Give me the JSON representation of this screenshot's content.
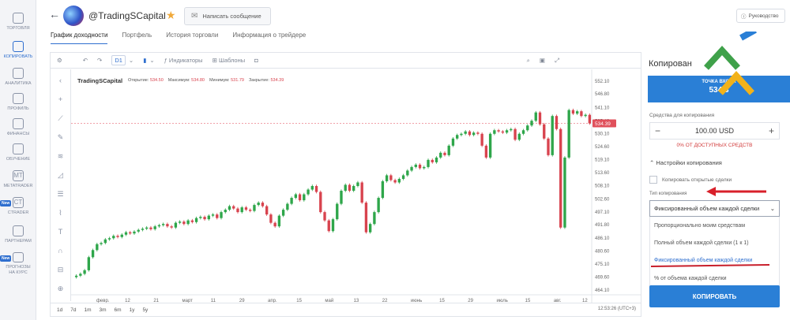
{
  "sidebar": {
    "items": [
      {
        "label": "ТОРГОВЛЯ",
        "icon": "trading-icon"
      },
      {
        "label": "КОПИРОВАТЬ",
        "icon": "copy-icon",
        "active": true
      },
      {
        "label": "АНАЛИТИКА",
        "icon": "analytics-icon"
      },
      {
        "label": "ПРОФИЛЬ",
        "icon": "profile-icon"
      },
      {
        "label": "ФИНАНСЫ",
        "icon": "finance-icon"
      },
      {
        "label": "ОБУЧЕНИЕ",
        "icon": "education-icon"
      },
      {
        "label": "METATRADER",
        "icon": "metatrader-icon",
        "icon_text": "MT"
      },
      {
        "label": "CTRADER",
        "icon": "ctrader-icon",
        "icon_text": "CT",
        "badge": "New"
      },
      {
        "label": "ПАРТНЕРАМ",
        "icon": "partners-icon"
      },
      {
        "label": "ПРОГНОЗЫ\nНА КУРС",
        "icon": "forecast-icon",
        "badge": "New"
      }
    ]
  },
  "header": {
    "trader_name": "@TradingSCapital",
    "message_button": "Написать сообщение",
    "guide_button": "Руководство",
    "tabs": [
      "График доходности",
      "Портфель",
      "История торговли",
      "Информация о трейдере"
    ]
  },
  "toolbar": {
    "timeframe": "D1",
    "indicators": "Индикаторы",
    "templates": "Шаблоны"
  },
  "chart_data": {
    "type": "candlestick",
    "title": "TradingSCapital",
    "ohlc": {
      "open_label": "Открытие:",
      "open": "534.50",
      "high_label": "Максимум:",
      "high": "534.80",
      "low_label": "Минимум:",
      "low": "531.79",
      "close_label": "Закрытие:",
      "close": "534.39"
    },
    "current_price": "534.39",
    "y_ticks": [
      "552.10",
      "546.80",
      "541.10",
      "535.40",
      "530.10",
      "524.60",
      "519.10",
      "513.60",
      "508.10",
      "502.60",
      "497.10",
      "491.80",
      "486.10",
      "480.60",
      "475.10",
      "469.60",
      "464.10"
    ],
    "x_ticks": [
      "февр.",
      "12",
      "21",
      "март",
      "11",
      "29",
      "апр.",
      "15",
      "май",
      "13",
      "22",
      "июнь",
      "15",
      "29",
      "июль",
      "15",
      "авг.",
      "12"
    ],
    "ylim": [
      461.5,
      554.5
    ],
    "closes": [
      470.2,
      471.0,
      472.5,
      478.0,
      481.0,
      483.5,
      484.0,
      485.5,
      486.0,
      487.0,
      486.5,
      487.5,
      488.5,
      488.0,
      488.8,
      489.5,
      490.0,
      490.5,
      489.8,
      491.0,
      491.5,
      492.0,
      491.0,
      490.5,
      492.5,
      493.0,
      492.0,
      493.5,
      492.8,
      494.5,
      495.0,
      494.0,
      495.5,
      496.0,
      494.5,
      497.0,
      498.0,
      499.5,
      498.5,
      497.0,
      499.0,
      498.0,
      497.5,
      500.0,
      501.0,
      499.5,
      496.0,
      492.5,
      491.0,
      495.5,
      498.0,
      500.5,
      503.0,
      504.5,
      502.0,
      504.5,
      506.5,
      508.0,
      505.5,
      497.0,
      493.5,
      489.0,
      494.0,
      500.5,
      506.0,
      508.5,
      506.0,
      508.0,
      509.5,
      501.0,
      488.5,
      492.0,
      497.0,
      503.0,
      510.0,
      512.5,
      510.5,
      509.5,
      511.0,
      512.5,
      514.5,
      516.0,
      517.0,
      515.5,
      516.0,
      519.0,
      518.0,
      520.0,
      522.0,
      521.0,
      525.0,
      528.0,
      529.5,
      530.0,
      531.0,
      529.5,
      530.5,
      530.0,
      525.0,
      520.0,
      530.0,
      531.5,
      531.0,
      530.5,
      531.5,
      532.0,
      527.5,
      530.0,
      531.5,
      533.5,
      535.5,
      539.0,
      534.0,
      528.0,
      521.0,
      537.5,
      532.0,
      490.5,
      520.0,
      540.0,
      538.5,
      539.5,
      537.5,
      538.0,
      534.4
    ]
  },
  "time_ranges": [
    "1d",
    "7d",
    "1m",
    "3m",
    "6m",
    "1y",
    "5y"
  ],
  "clock": "12:53:26 (UTC+3)",
  "copy_panel": {
    "title": "Копирован",
    "badge_text": "ТОЧКА ВХОДА",
    "badge_value": "534.3",
    "funds_label": "Средства для копирования",
    "funds_value": "100.00 USD",
    "minus": "−",
    "plus": "+",
    "funds_pct": "0% ОТ ДОСТУПНЫХ СРЕДСТВ",
    "settings_label": "Настройки копирования",
    "copy_open_trades": "Копировать открытые сделки",
    "type_label": "Тип копирования",
    "selected_type": "Фиксированный объем каждой сделки",
    "options": [
      "Пропорционально моим средствам",
      "Полный объем каждой сделки (1 к 1)",
      "Фиксированный объем каждой сделки",
      "% от объема каждой сделки"
    ],
    "copy_button": "КОПИРОВАТЬ"
  },
  "colors": {
    "accent": "#2f6fcf",
    "bull": "#2ea64a",
    "bear": "#d8434e",
    "button": "#2a7fd6"
  }
}
